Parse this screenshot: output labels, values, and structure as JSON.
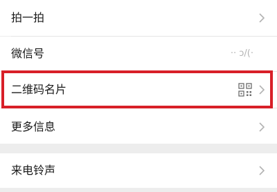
{
  "settings": {
    "items": [
      {
        "label": "拍一拍"
      },
      {
        "label": "微信号",
        "value": "·· ɔ/(·"
      },
      {
        "label": "二维码名片"
      },
      {
        "label": "更多信息"
      },
      {
        "label": "来电铃声"
      }
    ]
  },
  "icons": {
    "chevron": "chevron-right-icon",
    "qr": "qr-code-icon"
  },
  "colors": {
    "background": "#ededed",
    "row": "#ffffff",
    "text": "#191919",
    "secondary": "#b2b2b2",
    "highlight": "#d81f28"
  }
}
